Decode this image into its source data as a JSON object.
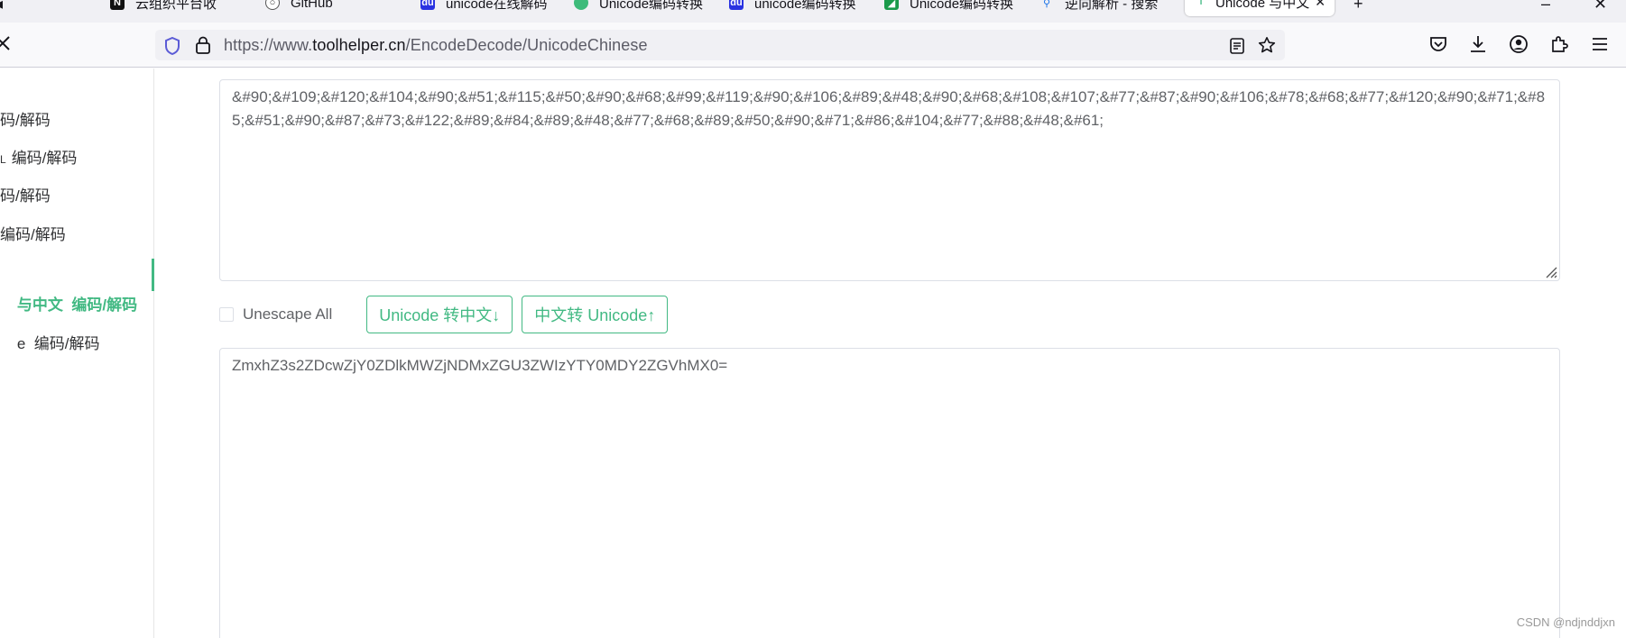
{
  "browser": {
    "tabs": [
      {
        "label": "云组织平台收",
        "icon": "notion-icon"
      },
      {
        "label": "GitHub",
        "icon": "github-icon"
      },
      {
        "label": "unicode在线解码",
        "icon": "baidu-du-icon"
      },
      {
        "label": "Unicode编码转换",
        "icon": "leaf-icon"
      },
      {
        "label": "unicode编码转换",
        "icon": "baidu-du-icon"
      },
      {
        "label": "Unicode编码转换",
        "icon": "green-square-icon"
      },
      {
        "label": "逆向解析 - 搜索",
        "icon": "search-icon"
      },
      {
        "label": "Unicode 与中文",
        "icon": "toolhelper-icon",
        "active": true
      }
    ],
    "url": {
      "scheme": "https://www.",
      "host": "toolhelper.cn",
      "path": "/EncodeDecode/UnicodeChinese"
    }
  },
  "sidebar": {
    "items": [
      {
        "label": "码/解码"
      },
      {
        "label": "编码/解码",
        "prefix": "L"
      },
      {
        "label": "码/解码"
      },
      {
        "label": "编码/解码"
      },
      {
        "label": "与中文  编码/解码",
        "active": true
      },
      {
        "label": "e  编码/解码"
      }
    ]
  },
  "main": {
    "input_text": "&#90;&#109;&#120;&#104;&#90;&#51;&#115;&#50;&#90;&#68;&#99;&#119;&#90;&#106;&#89;&#48;&#90;&#68;&#108;&#107;&#77;&#87;&#90;&#106;&#78;&#68;&#77;&#120;&#90;&#71;&#85;&#51;&#90;&#87;&#73;&#122;&#89;&#84;&#89;&#48;&#77;&#68;&#89;&#50;&#90;&#71;&#86;&#104;&#77;&#88;&#48;&#61;",
    "unescape_label": "Unescape All",
    "unescape_checked": false,
    "btn_to_chinese": "Unicode 转中文↓",
    "btn_to_unicode": "中文转 Unicode↑",
    "output_text": "ZmxhZ3s2ZDcwZjY0ZDlkMWZjNDMxZGU3ZWIzYTY0MDY2ZGVhMX0="
  },
  "watermark": "CSDN @ndjnddjxn",
  "colors": {
    "accent": "#42b983",
    "border": "#dcdfe6",
    "text": "#606266"
  }
}
